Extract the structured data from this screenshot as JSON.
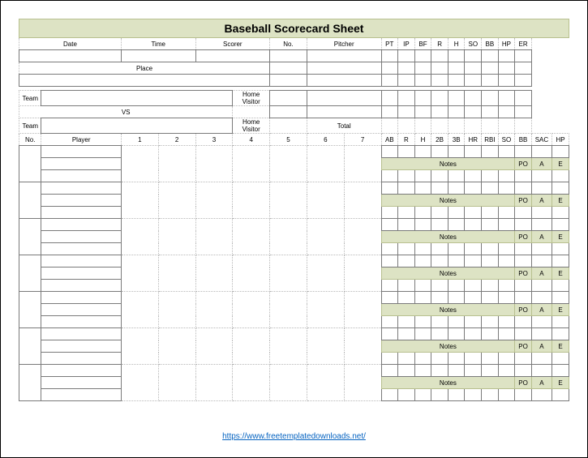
{
  "title": "Baseball Scorecard Sheet",
  "header_labels": [
    "Date",
    "Time",
    "Scorer",
    "No.",
    "Pitcher"
  ],
  "pitcher_stat_labels": [
    "PT",
    "IP",
    "BF",
    "R",
    "H",
    "SO",
    "BB",
    "HP",
    "ER"
  ],
  "place_label": "Place",
  "team_label": "Team",
  "vs_label": "VS",
  "home_visitor_label": "Home Visitor",
  "total_label": "Total",
  "player_header": {
    "no": "No.",
    "player": "Player",
    "innings": [
      "1",
      "2",
      "3",
      "4",
      "5",
      "6",
      "7"
    ],
    "stats": [
      "AB",
      "R",
      "H",
      "2B",
      "3B",
      "HR",
      "RBI",
      "SO",
      "BB",
      "SAC",
      "HP"
    ]
  },
  "notes_label": "Notes",
  "poae_labels": [
    "PO",
    "A",
    "E"
  ],
  "notes_rows": 7,
  "footer_url": "https://www.freetemplatedownloads.net/"
}
